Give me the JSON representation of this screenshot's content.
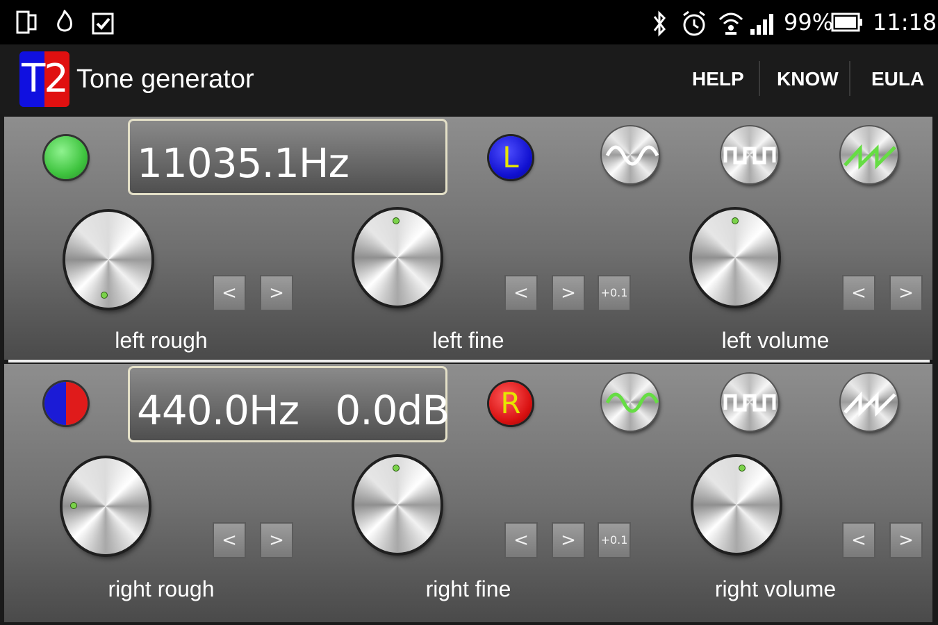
{
  "status_bar": {
    "battery": "99%",
    "time": "11:18",
    "icons": [
      "sim-dual-icon",
      "fire-app-icon",
      "clipboard-check-icon",
      "bluetooth-icon",
      "alarm-icon",
      "wifi-icon",
      "signal-icon",
      "battery-icon"
    ]
  },
  "action_bar": {
    "logo_text": "T2",
    "title": "Tone generator",
    "menu": {
      "help": "HELP",
      "know": "KNOW",
      "eula": "EULA"
    }
  },
  "left_channel": {
    "display": "11035.1Hz",
    "channel_label": "L",
    "selected_wave": "saw",
    "knob_labels": {
      "rough": "left rough",
      "fine": "left fine",
      "volume": "left volume"
    }
  },
  "right_channel": {
    "display": "440.0Hz   0.0dB",
    "channel_label": "R",
    "selected_wave": "sine",
    "knob_labels": {
      "rough": "right rough",
      "fine": "right fine",
      "volume": "right volume"
    }
  },
  "buttons": {
    "prev": "<",
    "next": ">",
    "reset": "+0.1"
  },
  "colors": {
    "green": "#55d455",
    "blue": "#1b1bd6",
    "red": "#e01b1b",
    "yellow": "#e6e600",
    "wave_active": "#66dd44"
  }
}
